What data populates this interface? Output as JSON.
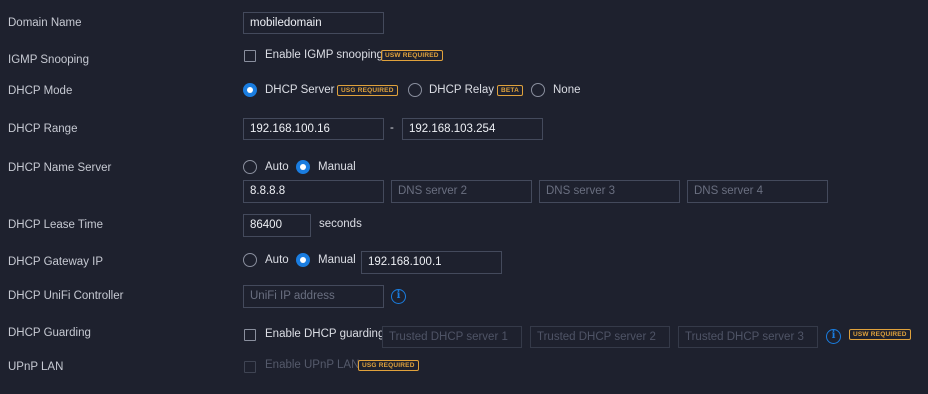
{
  "domain_name": {
    "label": "Domain Name",
    "value": "mobiledomain"
  },
  "igmp": {
    "label": "IGMP Snooping",
    "checkbox_label": "Enable IGMP snooping",
    "badge": "USW REQUIRED"
  },
  "dhcp_mode": {
    "label": "DHCP Mode",
    "options": [
      "DHCP Server",
      "DHCP Relay",
      "None"
    ],
    "selected": "DHCP Server",
    "server_badge": "USG REQUIRED",
    "relay_badge": "BETA"
  },
  "dhcp_range": {
    "label": "DHCP Range",
    "start": "192.168.100.16",
    "separator": "-",
    "end": "192.168.103.254"
  },
  "name_server": {
    "label": "DHCP Name Server",
    "options": [
      "Auto",
      "Manual"
    ],
    "selected": "Manual",
    "dns1": "8.8.8.8",
    "dns2_placeholder": "DNS server 2",
    "dns3_placeholder": "DNS server 3",
    "dns4_placeholder": "DNS server 4"
  },
  "lease": {
    "label": "DHCP Lease Time",
    "value": "86400",
    "unit": "seconds"
  },
  "gateway": {
    "label": "DHCP Gateway IP",
    "options": [
      "Auto",
      "Manual"
    ],
    "selected": "Manual",
    "value": "192.168.100.1"
  },
  "controller": {
    "label": "DHCP UniFi Controller",
    "placeholder": "UniFi IP address",
    "info_icon": "i"
  },
  "guarding": {
    "label": "DHCP Guarding",
    "checkbox_label": "Enable DHCP guarding",
    "server1_placeholder": "Trusted DHCP server 1",
    "server2_placeholder": "Trusted DHCP server 2",
    "server3_placeholder": "Trusted DHCP server 3",
    "info_icon": "i",
    "badge": "USW REQUIRED"
  },
  "upnp": {
    "label": "UPnP LAN",
    "checkbox_label": "Enable UPnP LAN",
    "badge": "USG REQUIRED"
  },
  "colors": {
    "background": "#1e212e",
    "accent": "#1a7de0",
    "badge": "#e0a23c",
    "border": "#444a5c"
  }
}
